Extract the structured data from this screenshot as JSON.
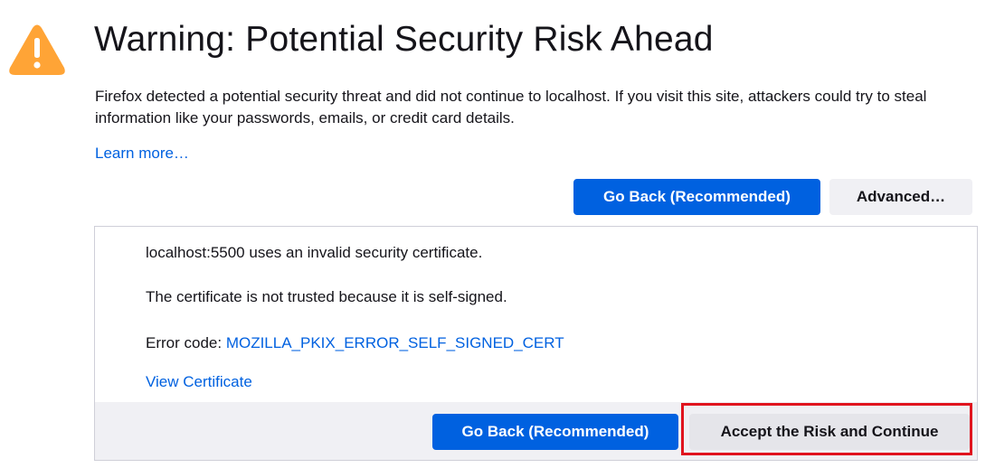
{
  "header": {
    "icon": "warning-triangle-icon",
    "icon_color": "#ffa436",
    "title": "Warning: Potential Security Risk Ahead"
  },
  "description": "Firefox detected a potential security threat and did not continue to localhost. If you visit this site, attackers could try to steal information like your passwords, emails, or credit card details.",
  "learn_more": "Learn more…",
  "actions": {
    "go_back_label": "Go Back (Recommended)",
    "advanced_label": "Advanced…"
  },
  "advanced_panel": {
    "line1": "localhost:5500 uses an invalid security certificate.",
    "line2": "The certificate is not trusted because it is self-signed.",
    "error_prefix": "Error code: ",
    "error_code": "MOZILLA_PKIX_ERROR_SELF_SIGNED_CERT",
    "view_certificate": "View Certificate",
    "go_back_label": "Go Back (Recommended)",
    "accept_label": "Accept the Risk and Continue"
  },
  "colors": {
    "primary": "#0061e0",
    "link": "#0061e0",
    "highlight": "#e0141e"
  }
}
